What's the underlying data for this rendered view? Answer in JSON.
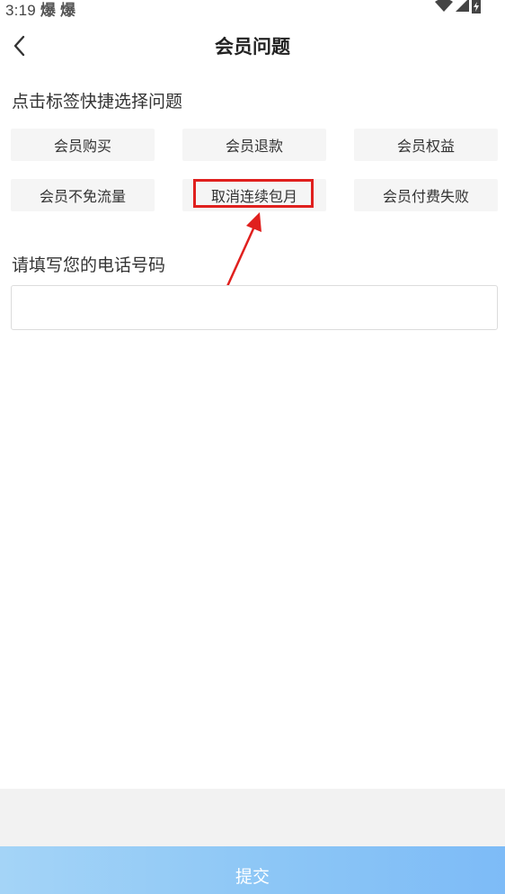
{
  "status_bar": {
    "time": "3:19",
    "notification_icons": [
      "爆",
      "爆"
    ]
  },
  "header": {
    "title": "会员问题"
  },
  "quick_tags": {
    "label": "点击标签快捷选择问题",
    "tags": [
      "会员购买",
      "会员退款",
      "会员权益",
      "会员不免流量",
      "取消连续包月",
      "会员付费失败"
    ],
    "highlighted_tag": "取消连续包月"
  },
  "phone": {
    "label": "请填写您的电话号码",
    "value": "",
    "placeholder": ""
  },
  "submit": {
    "label": "提交"
  },
  "colors": {
    "annotation": "#e0201e",
    "submit_gradient_start": "#a4d4f7",
    "submit_gradient_end": "#7dbbf7",
    "tag_background": "#f5f5f5"
  }
}
